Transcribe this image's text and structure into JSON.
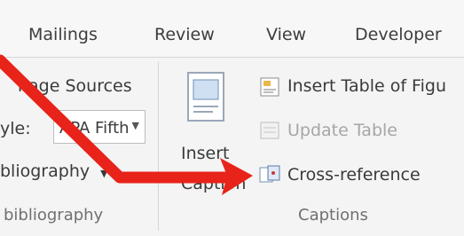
{
  "tabs": [
    "Mailings",
    "Review",
    "View",
    "Developer"
  ],
  "citations": {
    "manage_sources_label": "nage Sources",
    "style_label": "yle:",
    "style_value": "APA Fifth",
    "bibliography_label": "bliography",
    "group_label": "bibliography"
  },
  "captions": {
    "insert_caption_line1": "Insert",
    "insert_caption_line2": "Caption",
    "insert_table_of_figures": "Insert Table of Figu",
    "update_table": "Update Table",
    "cross_reference": "Cross-reference",
    "group_label": "Captions"
  },
  "colors": {
    "arrow": "#e8231a",
    "tab_text": "#3d3d3d",
    "disabled_text": "#a6a6a6"
  },
  "icons": {
    "insert_caption": "insert-caption-icon",
    "insert_table_of_figures": "table-of-figures-icon",
    "update_table": "update-table-icon",
    "cross_reference": "cross-reference-icon"
  }
}
